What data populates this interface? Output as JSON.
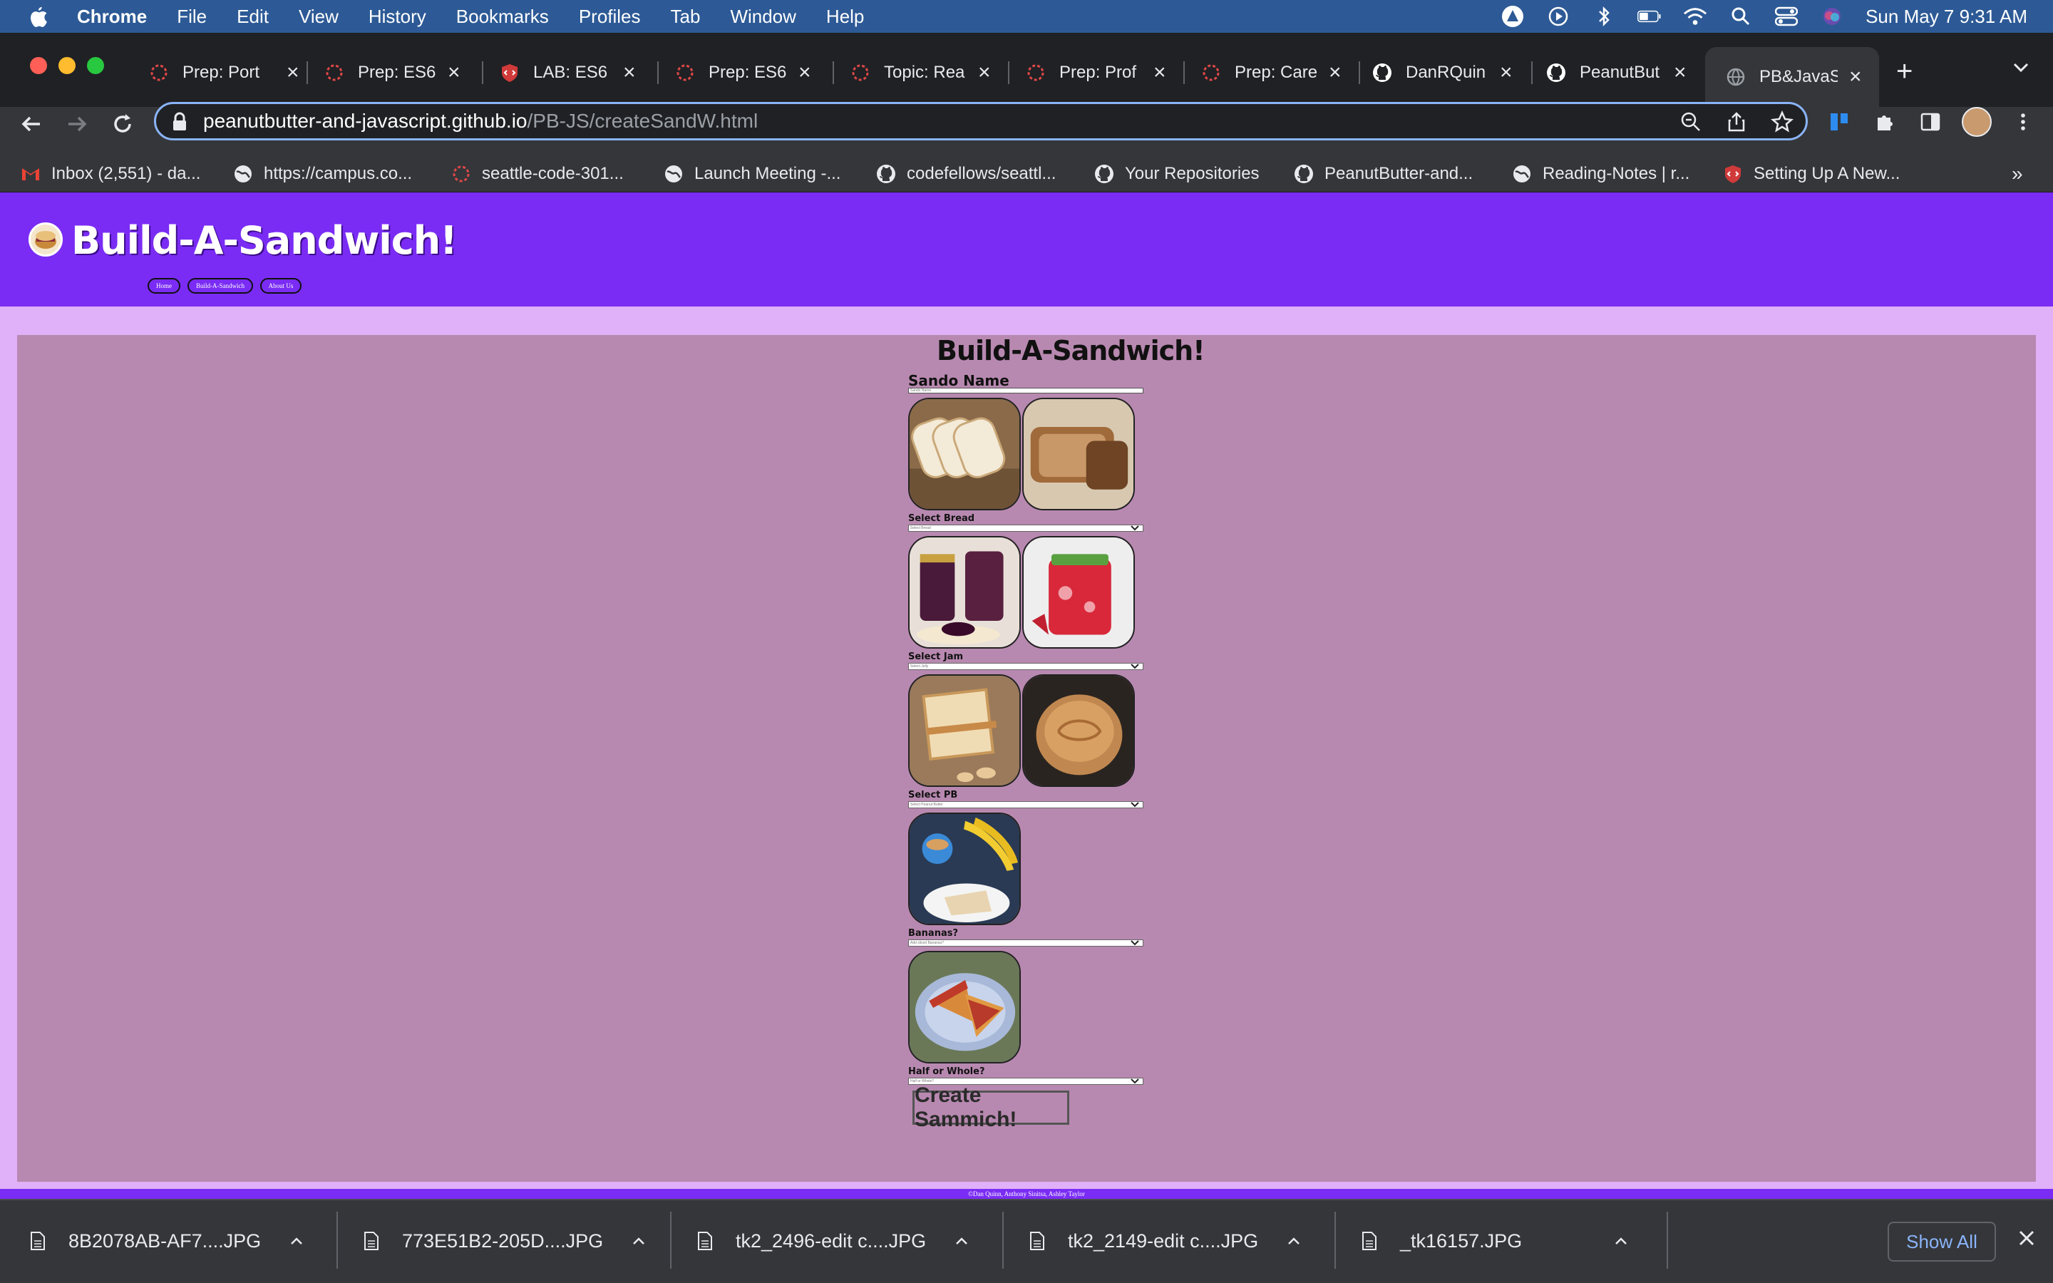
{
  "menubar": {
    "app": "Chrome",
    "items": [
      "File",
      "Edit",
      "View",
      "History",
      "Bookmarks",
      "Profiles",
      "Tab",
      "Window",
      "Help"
    ],
    "datetime": "Sun May 7  9:31 AM"
  },
  "tabs": [
    {
      "title": "Prep: Port",
      "icon": "codefellows-icon"
    },
    {
      "title": "Prep: ES6",
      "icon": "codefellows-icon"
    },
    {
      "title": "LAB: ES6 (",
      "icon": "shield-icon"
    },
    {
      "title": "Prep: ES6",
      "icon": "codefellows-icon"
    },
    {
      "title": "Topic: Rea",
      "icon": "codefellows-icon"
    },
    {
      "title": "Prep: Prof",
      "icon": "codefellows-icon"
    },
    {
      "title": "Prep: Care",
      "icon": "codefellows-icon"
    },
    {
      "title": "DanRQuin",
      "icon": "github-icon"
    },
    {
      "title": "PeanutBut",
      "icon": "github-icon"
    },
    {
      "title": "PB&JavaS",
      "icon": "globe-icon",
      "active": true
    }
  ],
  "omnibox": {
    "host": "peanutbutter-and-javascript.github.io",
    "path": "/PB-JS/createSandW.html"
  },
  "bookmarks": [
    {
      "label": "Inbox (2,551) - da...",
      "icon": "gmail-icon"
    },
    {
      "label": "https://campus.co...",
      "icon": "globe-icon"
    },
    {
      "label": "seattle-code-301...",
      "icon": "codefellows-icon"
    },
    {
      "label": "Launch Meeting -...",
      "icon": "globe-icon"
    },
    {
      "label": "codefellows/seattl...",
      "icon": "github-icon"
    },
    {
      "label": "Your Repositories",
      "icon": "github-icon"
    },
    {
      "label": "PeanutButter-and...",
      "icon": "github-icon"
    },
    {
      "label": "Reading-Notes | r...",
      "icon": "globe-icon"
    },
    {
      "label": "Setting Up A New...",
      "icon": "shield-icon"
    }
  ],
  "bookmarks_overflow": "»",
  "site": {
    "title": "Build-A-Sandwich!",
    "nav": [
      "Home",
      "Build-A-Sandwich",
      "About Us"
    ],
    "footer": "©Dan Quinn, Anthony Sinitsa, Ashley Taylor"
  },
  "form": {
    "heading": "Build-A-Sandwich!",
    "name_label": "Sando Name",
    "name_placeholder": "Sando Name",
    "sections": [
      {
        "label": "Select Bread",
        "select": "Select Bread"
      },
      {
        "label": "Select Jam",
        "select": "Select Jelly"
      },
      {
        "label": "Select PB",
        "select": "Select Peanut Butter"
      },
      {
        "label": "Bananas?",
        "select": "Add sliced Bananas?"
      },
      {
        "label": "Half or Whole?",
        "select": "Half or Whole?"
      }
    ],
    "submit": "Create Sammich!"
  },
  "downloads": [
    "8B2078AB-AF7....JPG",
    "773E51B2-205D....JPG",
    "tk2_2496-edit c....JPG",
    "tk2_2149-edit c....JPG",
    "_tk16157.JPG"
  ],
  "downloads_show_all": "Show All",
  "colors": {
    "header": "#7a2cf4",
    "page_bg": "#e0b0f8",
    "main_bg": "#b889b0",
    "menubar": "#2d5a96"
  }
}
